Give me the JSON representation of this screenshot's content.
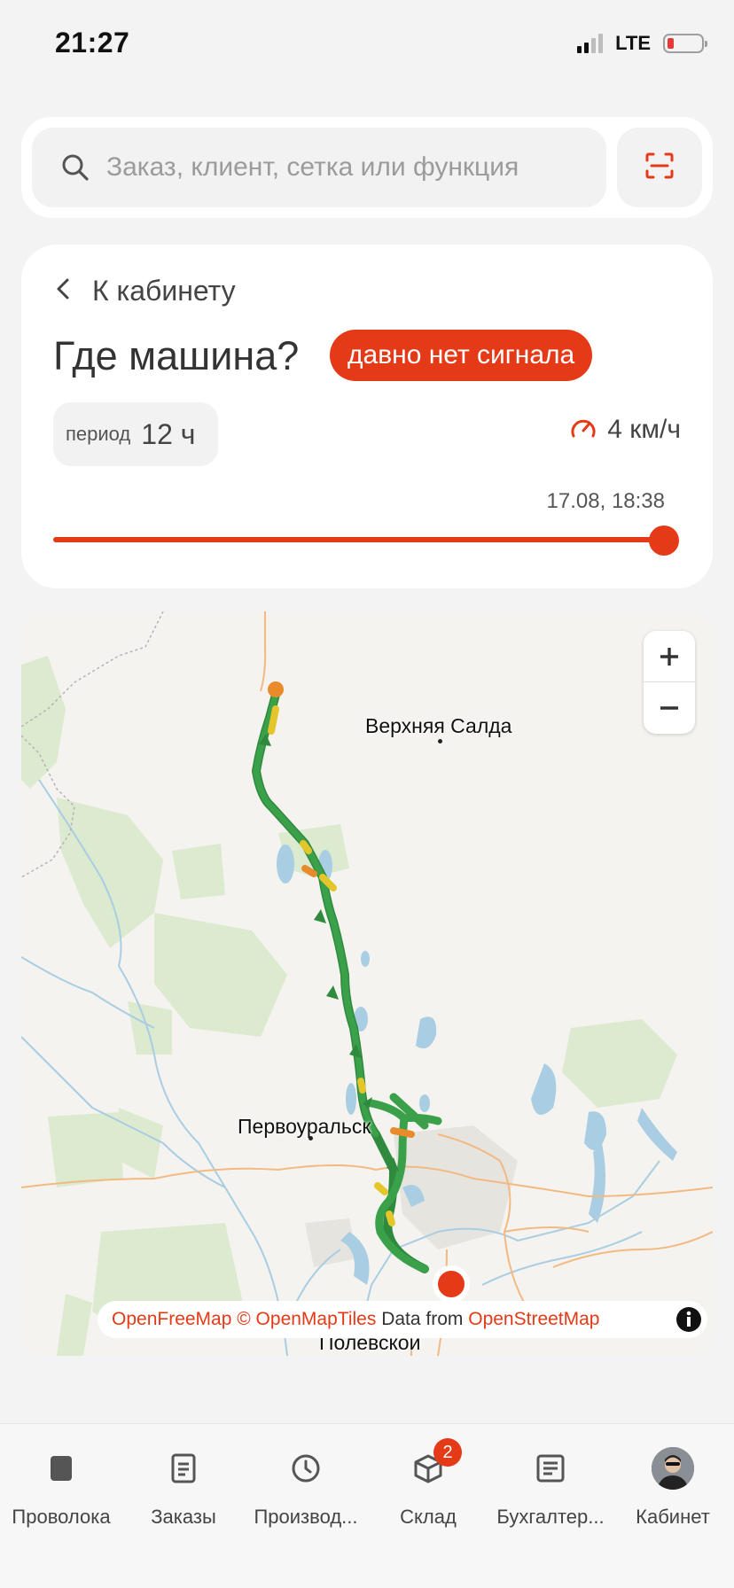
{
  "status_bar": {
    "time": "21:27",
    "network": "LTE"
  },
  "search": {
    "placeholder": "Заказ, клиент, сетка или функция"
  },
  "card": {
    "back_label": "К кабинету",
    "title": "Где машина?",
    "status_badge": "давно нет сигнала",
    "period_label": "период",
    "period_value": "12 ч",
    "speed": "4 км/ч",
    "timestamp": "17.08, 18:38",
    "slider_position": 1.0
  },
  "map": {
    "cities": [
      "Верхняя Салда",
      "Первоуральск",
      "Полевской"
    ],
    "attribution": {
      "openfreemap": "OpenFreeMap",
      "copyright": "© OpenMapTiles",
      "data_from": "Data from",
      "osm": "OpenStreetMap"
    },
    "route_color": "#3aa04a",
    "marker_color": "#e53a17"
  },
  "nav": {
    "items": [
      {
        "label": "Проволока",
        "icon": "spool-icon"
      },
      {
        "label": "Заказы",
        "icon": "document-icon"
      },
      {
        "label": "Производ...",
        "icon": "clock-icon"
      },
      {
        "label": "Склад",
        "icon": "box-icon",
        "badge": "2"
      },
      {
        "label": "Бухгалтер...",
        "icon": "ledger-icon"
      },
      {
        "label": "Кабинет",
        "icon": "avatar"
      }
    ]
  },
  "accent_color": "#e53a17"
}
